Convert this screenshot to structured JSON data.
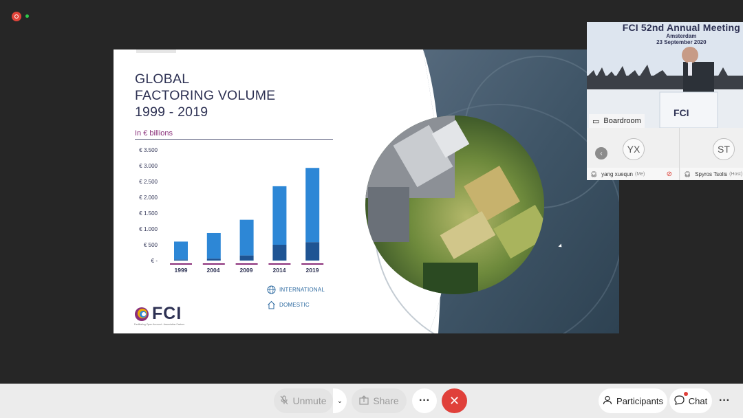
{
  "slide": {
    "title_lines": [
      "GLOBAL",
      "FACTORING VOLUME",
      "1999 - 2019"
    ],
    "unit_label": "In € billions",
    "legend": {
      "international": "INTERNATIONAL",
      "domestic": "DOMESTIC"
    },
    "logo_text": "FCI",
    "logo_subtext": "Facilitating Open Account - Association Factors"
  },
  "chart_data": {
    "type": "bar",
    "stacked": true,
    "categories": [
      "1999",
      "2004",
      "2009",
      "2014",
      "2019"
    ],
    "series": [
      {
        "name": "DOMESTIC",
        "values": [
          30,
          60,
          160,
          500,
          580
        ]
      },
      {
        "name": "INTERNATIONAL",
        "values": [
          570,
          810,
          1130,
          1850,
          2350
        ]
      }
    ],
    "y_ticks": [
      "€ 3.500",
      "€ 3.000",
      "€ 2.500",
      "€ 2.000",
      "€ 1.500",
      "€ 1.000",
      "€ 500",
      "€ -"
    ],
    "ylim": [
      0,
      3500
    ],
    "colors": {
      "international": "#2d87d6",
      "domestic": "#1f5493",
      "underline": "#8a2f7a"
    }
  },
  "video": {
    "banner_title": "FCI 52nd Annual Meeting",
    "banner_city": "Amsterdam",
    "banner_date": "23 September 2020",
    "podium_logo": "FCI",
    "room_label": "Boardroom"
  },
  "participants_tiles": [
    {
      "initials": "YX",
      "name": "yang xuequn",
      "role": "(Me)"
    },
    {
      "initials": "ST",
      "name": "Spyros Tsolis",
      "role": "(Host)"
    }
  ],
  "toolbar": {
    "unmute": "Unmute",
    "share": "Share",
    "participants": "Participants",
    "chat": "Chat"
  },
  "colors": {
    "leave": "#e0403a",
    "accent_title": "#2d3153"
  }
}
